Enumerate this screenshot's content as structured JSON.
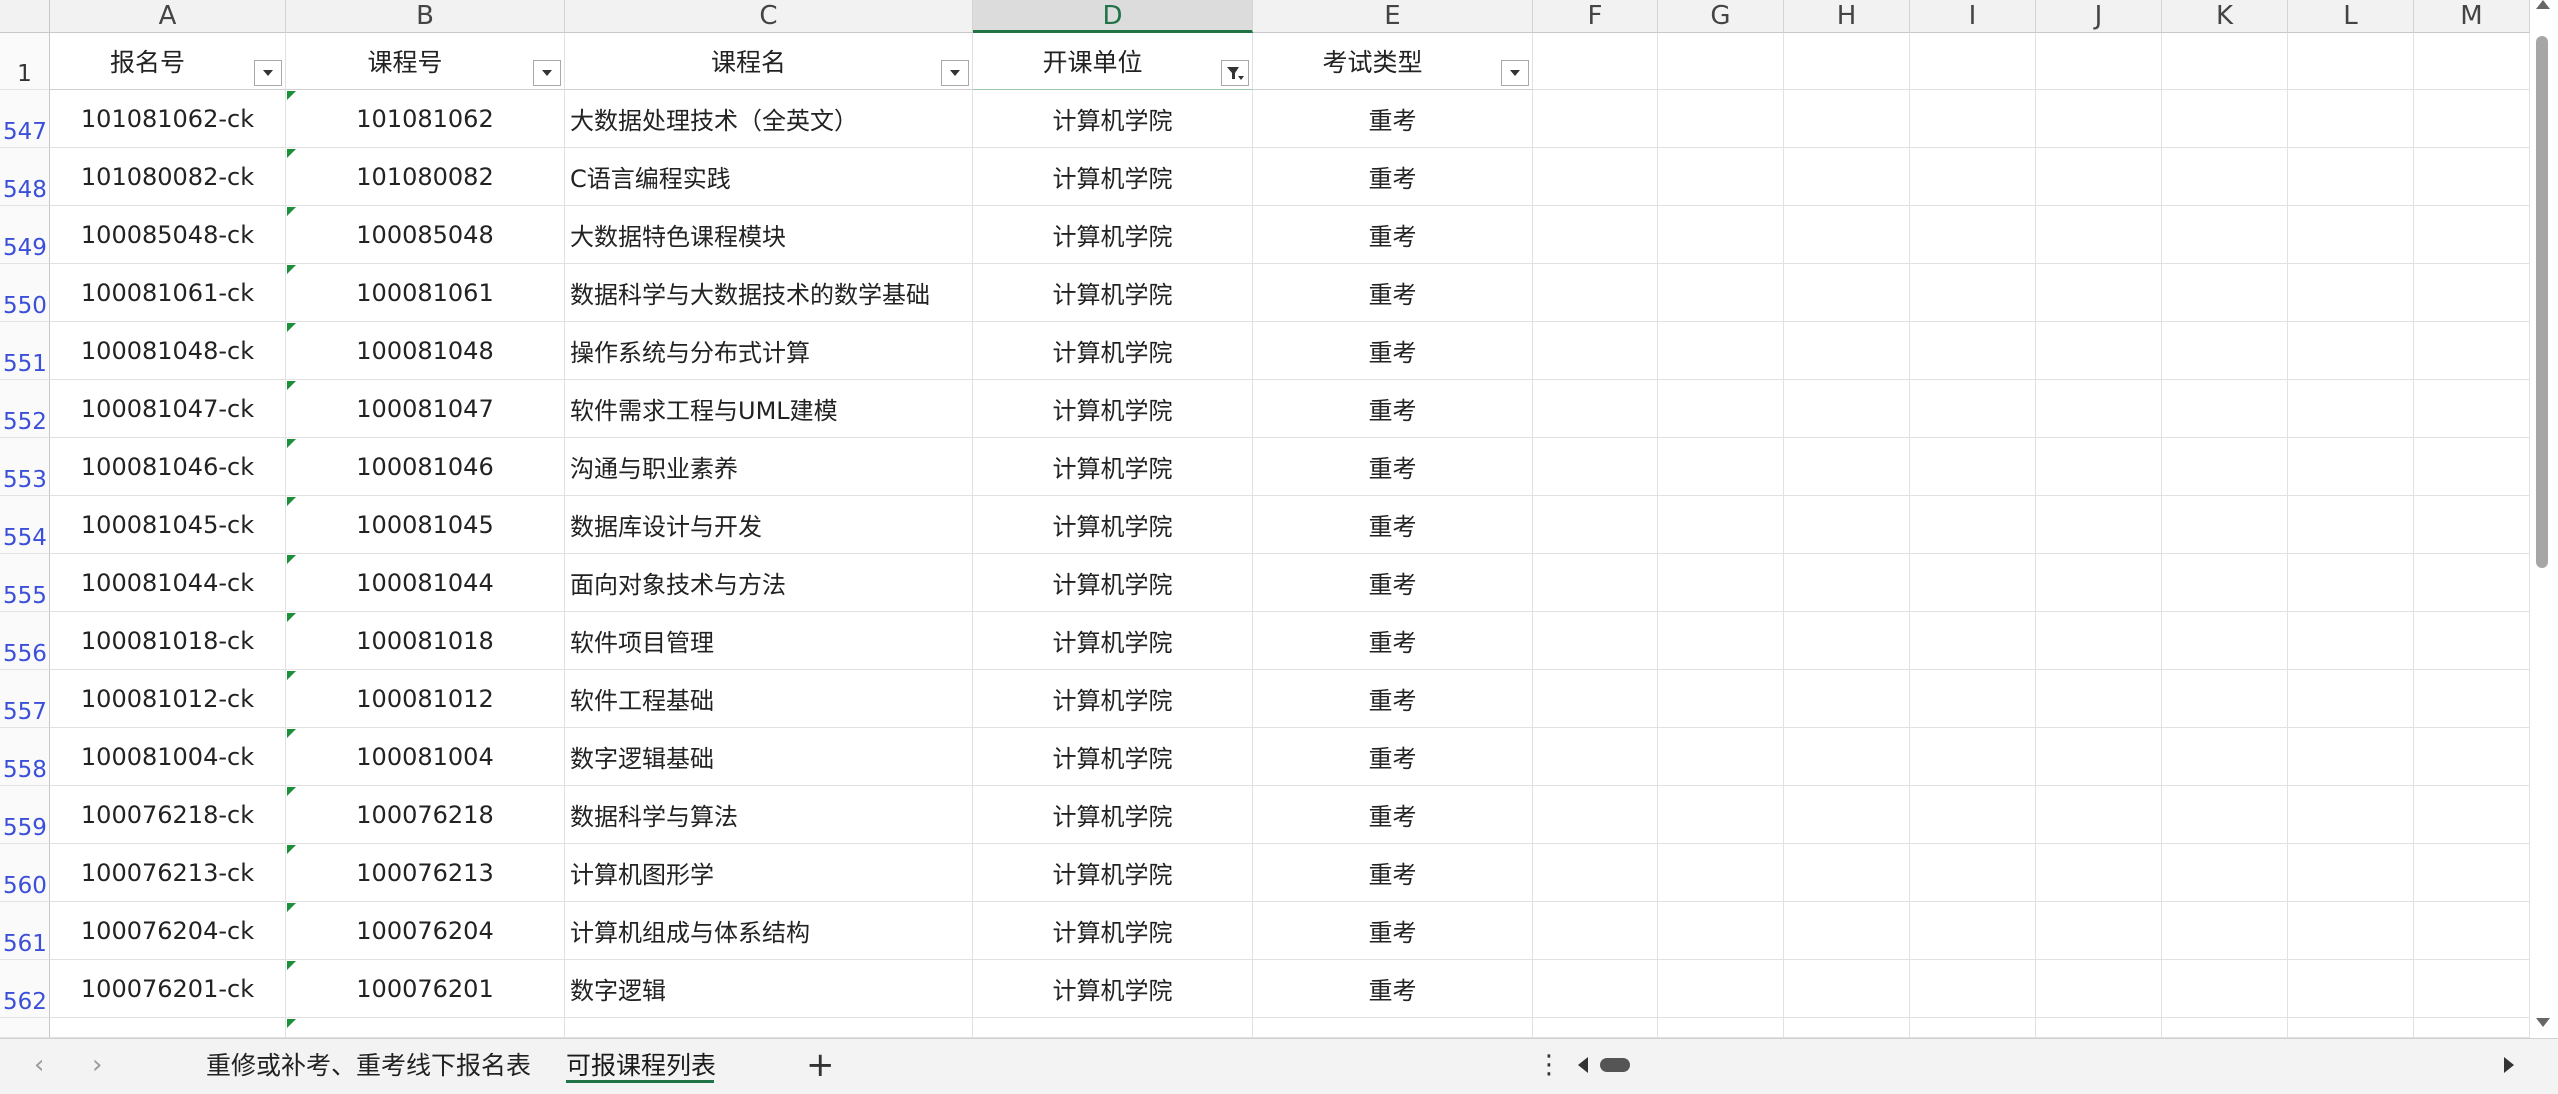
{
  "columns": [
    "A",
    "B",
    "C",
    "D",
    "E",
    "F",
    "G",
    "H",
    "I",
    "J",
    "K",
    "L",
    "M"
  ],
  "selected_column": "D",
  "header_row": {
    "row_number": "1",
    "cells": [
      "报名号",
      "课程号",
      "课程名",
      "开课单位",
      "考试类型"
    ]
  },
  "rows": [
    {
      "row_number": "547",
      "reg_no": "101081062-ck",
      "course_no": "101081062",
      "course_name": "大数据处理技术（全英文）",
      "unit": "计算机学院",
      "exam_type": "重考"
    },
    {
      "row_number": "548",
      "reg_no": "101080082-ck",
      "course_no": "101080082",
      "course_name": "C语言编程实践",
      "unit": "计算机学院",
      "exam_type": "重考"
    },
    {
      "row_number": "549",
      "reg_no": "100085048-ck",
      "course_no": "100085048",
      "course_name": "大数据特色课程模块",
      "unit": "计算机学院",
      "exam_type": "重考"
    },
    {
      "row_number": "550",
      "reg_no": "100081061-ck",
      "course_no": "100081061",
      "course_name": "数据科学与大数据技术的数学基础",
      "unit": "计算机学院",
      "exam_type": "重考"
    },
    {
      "row_number": "551",
      "reg_no": "100081048-ck",
      "course_no": "100081048",
      "course_name": "操作系统与分布式计算",
      "unit": "计算机学院",
      "exam_type": "重考"
    },
    {
      "row_number": "552",
      "reg_no": "100081047-ck",
      "course_no": "100081047",
      "course_name": "软件需求工程与UML建模",
      "unit": "计算机学院",
      "exam_type": "重考"
    },
    {
      "row_number": "553",
      "reg_no": "100081046-ck",
      "course_no": "100081046",
      "course_name": "沟通与职业素养",
      "unit": "计算机学院",
      "exam_type": "重考"
    },
    {
      "row_number": "554",
      "reg_no": "100081045-ck",
      "course_no": "100081045",
      "course_name": "数据库设计与开发",
      "unit": "计算机学院",
      "exam_type": "重考"
    },
    {
      "row_number": "555",
      "reg_no": "100081044-ck",
      "course_no": "100081044",
      "course_name": "面向对象技术与方法",
      "unit": "计算机学院",
      "exam_type": "重考"
    },
    {
      "row_number": "556",
      "reg_no": "100081018-ck",
      "course_no": "100081018",
      "course_name": "软件项目管理",
      "unit": "计算机学院",
      "exam_type": "重考"
    },
    {
      "row_number": "557",
      "reg_no": "100081012-ck",
      "course_no": "100081012",
      "course_name": "软件工程基础",
      "unit": "计算机学院",
      "exam_type": "重考"
    },
    {
      "row_number": "558",
      "reg_no": "100081004-ck",
      "course_no": "100081004",
      "course_name": "数字逻辑基础",
      "unit": "计算机学院",
      "exam_type": "重考"
    },
    {
      "row_number": "559",
      "reg_no": "100076218-ck",
      "course_no": "100076218",
      "course_name": "数据科学与算法",
      "unit": "计算机学院",
      "exam_type": "重考"
    },
    {
      "row_number": "560",
      "reg_no": "100076213-ck",
      "course_no": "100076213",
      "course_name": "计算机图形学",
      "unit": "计算机学院",
      "exam_type": "重考"
    },
    {
      "row_number": "561",
      "reg_no": "100076204-ck",
      "course_no": "100076204",
      "course_name": "计算机组成与体系结构",
      "unit": "计算机学院",
      "exam_type": "重考"
    },
    {
      "row_number": "562",
      "reg_no": "100076201-ck",
      "course_no": "100076201",
      "course_name": "数字逻辑",
      "unit": "计算机学院",
      "exam_type": "重考"
    }
  ],
  "sheet_tabs": [
    {
      "label": "重修或补考、重考线下报名表",
      "active": false
    },
    {
      "label": "可报课程列表",
      "active": true
    }
  ],
  "active_filter_column": "D",
  "colors": {
    "accent": "#217346",
    "row_number": "#3b4fd8",
    "green_triangle": "#1b8f3a"
  },
  "icons": [
    "filter-dropdown-icon",
    "filter-active-icon",
    "chevron-left-icon",
    "chevron-right-icon",
    "plus-icon",
    "more-vertical-icon",
    "scroll-left-icon",
    "scroll-right-icon",
    "scroll-up-icon",
    "scroll-down-icon"
  ]
}
